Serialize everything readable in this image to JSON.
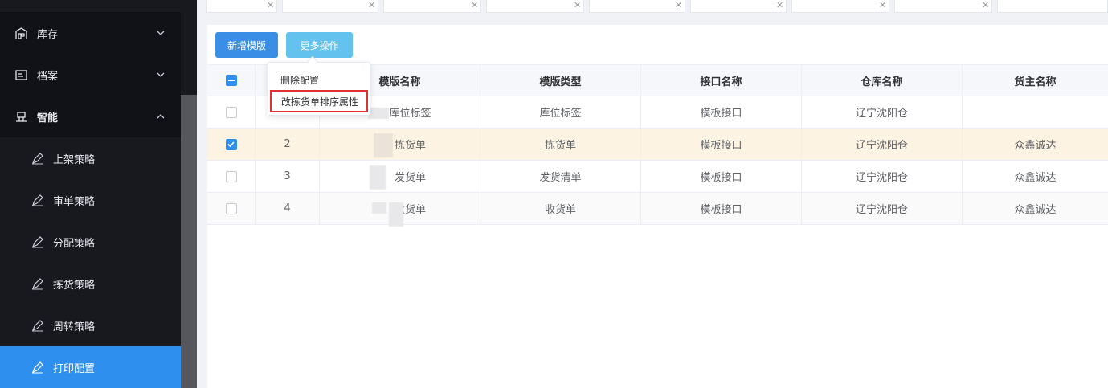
{
  "sidebar": {
    "items": [
      {
        "label": "库存",
        "icon": "warehouse-icon"
      },
      {
        "label": "档案",
        "icon": "archive-icon"
      },
      {
        "label": "智能",
        "icon": "robot-icon"
      }
    ],
    "sub_items": [
      {
        "label": "上架策略"
      },
      {
        "label": "审单策略"
      },
      {
        "label": "分配策略"
      },
      {
        "label": "拣货策略"
      },
      {
        "label": "周转策略"
      },
      {
        "label": "打印配置"
      }
    ]
  },
  "toolbar": {
    "add_label": "新增模版",
    "more_label": "更多操作"
  },
  "dropdown": {
    "items": [
      "删除配置",
      "改拣货单排序属性"
    ]
  },
  "table": {
    "headers": [
      "模版名称",
      "模版类型",
      "接口名称",
      "仓库名称",
      "货主名称"
    ],
    "rows": [
      {
        "index": "",
        "name": "库位标签",
        "type": "库位标签",
        "api": "模板接口",
        "warehouse": "辽宁沈阳仓",
        "owner": "",
        "checked": false
      },
      {
        "index": "2",
        "name": "拣货单",
        "type": "拣货单",
        "api": "模板接口",
        "warehouse": "辽宁沈阳仓",
        "owner": "众鑫诚达",
        "checked": true
      },
      {
        "index": "3",
        "name": "发货单",
        "type": "发货清单",
        "api": "模板接口",
        "warehouse": "辽宁沈阳仓",
        "owner": "众鑫诚达",
        "checked": false
      },
      {
        "index": "4",
        "name": "收货单",
        "type": "收货单",
        "api": "模板接口",
        "warehouse": "辽宁沈阳仓",
        "owner": "众鑫诚达",
        "checked": false
      }
    ]
  },
  "colors": {
    "accent": "#2f8fee",
    "selected_row": "#fdf3e3",
    "highlight_border": "#e03131"
  }
}
